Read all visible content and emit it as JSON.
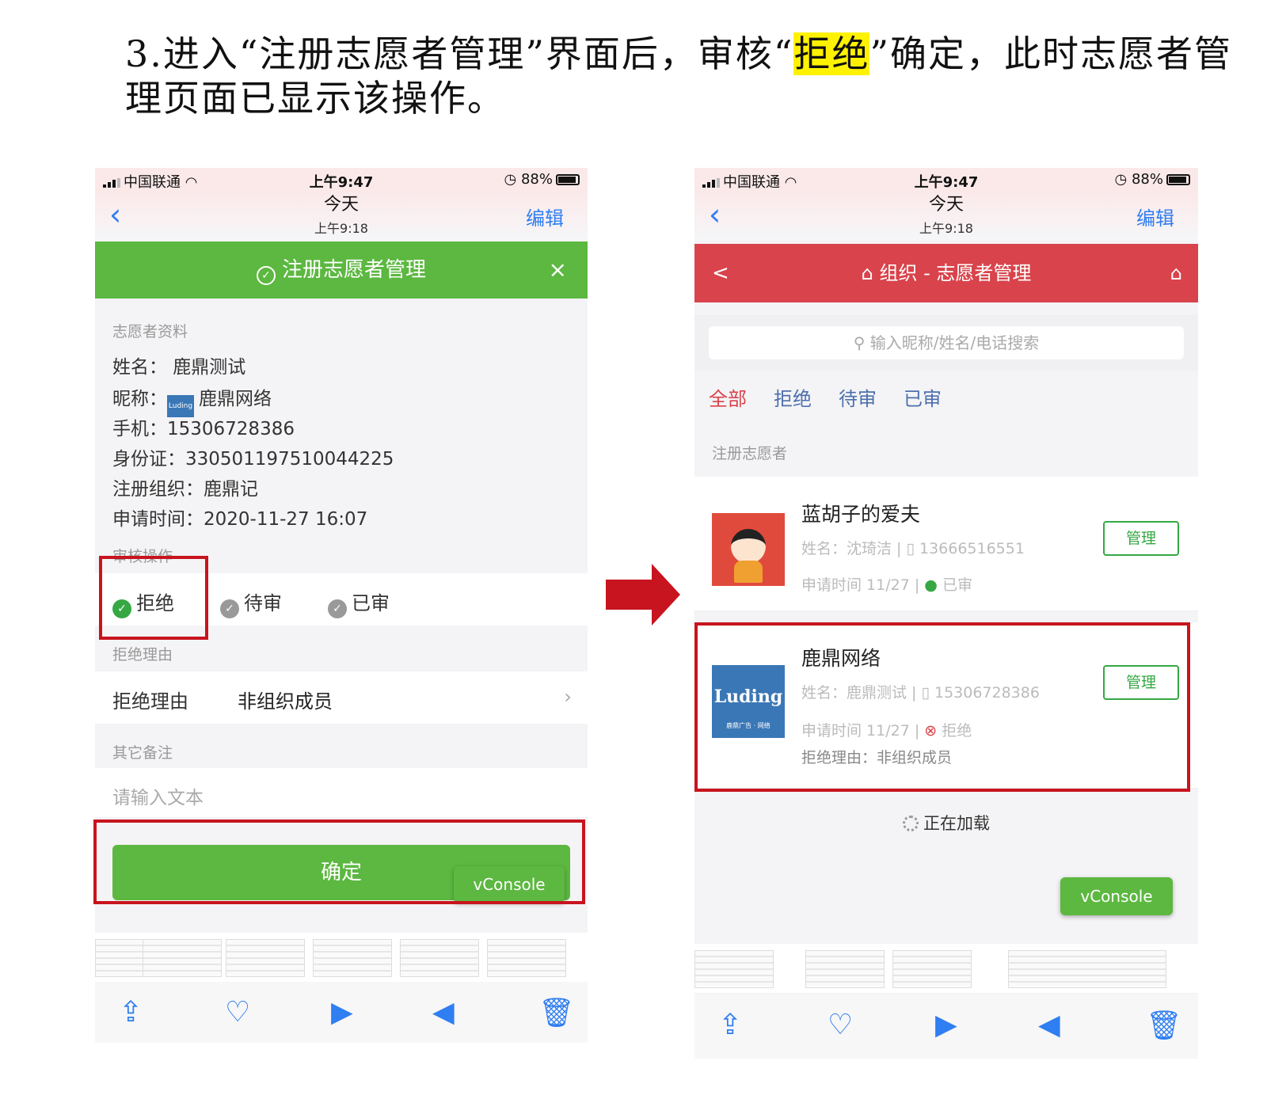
{
  "instruction": {
    "part1": "3.进入“注册志愿者管理”界面后，审核“",
    "highlight": "拒绝",
    "part2": "”确定，此时志愿者管理页面已显示该操作。"
  },
  "status_bar": {
    "carrier": "中国联通",
    "time": "上午9:47",
    "battery": "88%"
  },
  "nav": {
    "title": "今天",
    "subtitle": "上午9:18",
    "edit": "编辑",
    "back": "‹"
  },
  "left": {
    "header_title": "注册志愿者管理",
    "close": "×",
    "profile_section": "志愿者资料",
    "name": "姓名：  鹿鼎测试",
    "nickname_label": "昵称：",
    "nickname_logo": "Luding",
    "nickname": "鹿鼎网络",
    "phone": "手机：15306728386",
    "id_card": "身份证：330501197510044225",
    "org": "注册组织：鹿鼎记",
    "apply_time": "申请时间：2020-11-27 16:07",
    "review_section": "审核操作",
    "radio_reject": "拒绝",
    "radio_pending": "待审",
    "radio_approved": "已审",
    "reason_section": "拒绝理由",
    "reason_label": "拒绝理由",
    "reason_value": "非组织成员",
    "remarks_section": "其它备注",
    "remarks_placeholder": "请输入文本",
    "confirm": "确定",
    "vconsole": "vConsole"
  },
  "right": {
    "header_title": "组织 - 志愿者管理",
    "back": "<",
    "search_placeholder": "输入昵称/姓名/电话搜索",
    "tabs": [
      "全部",
      "拒绝",
      "待审",
      "已审"
    ],
    "list_section": "注册志愿者",
    "card1": {
      "name": "蓝胡子的爱夫",
      "meta1": "姓名：沈琦洁  |  ▯ 13666516551",
      "time": "申请时间 11/27  |",
      "status": "已审",
      "manage": "管理"
    },
    "card2": {
      "logo": "Luding",
      "logo_sub": "鹿鼎广告 · 网络",
      "name": "鹿鼎网络",
      "meta1": "姓名：鹿鼎测试  |  ▯ 15306728386",
      "time": "申请时间 11/27  |",
      "status": "拒绝",
      "reason": "拒绝理由：非组织成员",
      "manage": "管理"
    },
    "loading": "正在加载",
    "vconsole": "vConsole"
  },
  "colors": {
    "green": "#5cb840",
    "red_header": "#d9434b",
    "highlight_box": "#c8141e",
    "link_blue": "#2f7ef2"
  }
}
